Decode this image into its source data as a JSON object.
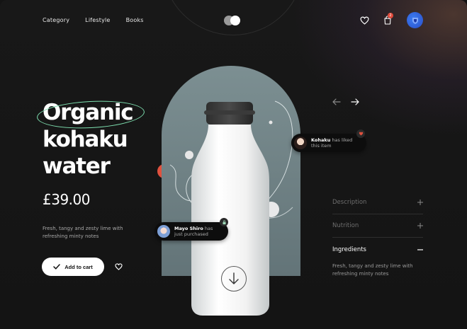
{
  "nav": {
    "items": [
      "Category",
      "Lifestyle",
      "Books"
    ]
  },
  "header": {
    "cart_count": "2",
    "icons": [
      "heart-icon",
      "shopping-bag-icon",
      "user-avatar"
    ]
  },
  "hero": {
    "title_lines": [
      "Organic",
      "kohaku",
      "water"
    ],
    "price": "£39.00",
    "description": "Fresh, tangy and zesty lime with refreshing minty notes",
    "add_to_cart_label": "Add to cart"
  },
  "notifications": [
    {
      "name": "Kohaku",
      "action": "has liked this item"
    },
    {
      "name": "Mayo Shiro",
      "action": "has just purchased"
    }
  ],
  "accordion": {
    "items": [
      {
        "label": "Description",
        "state": "collapsed"
      },
      {
        "label": "Nutrition",
        "state": "collapsed"
      },
      {
        "label": "Ingredients",
        "state": "expanded",
        "body": "Fresh, tangy and zesty lime with refreshing minty notes"
      }
    ]
  },
  "colors": {
    "background": "#141414",
    "accent_green": "#7ee0b0",
    "accent_red": "#e0513e",
    "arch": "#7c8f92",
    "avatar_blue": "#3c7df2"
  }
}
